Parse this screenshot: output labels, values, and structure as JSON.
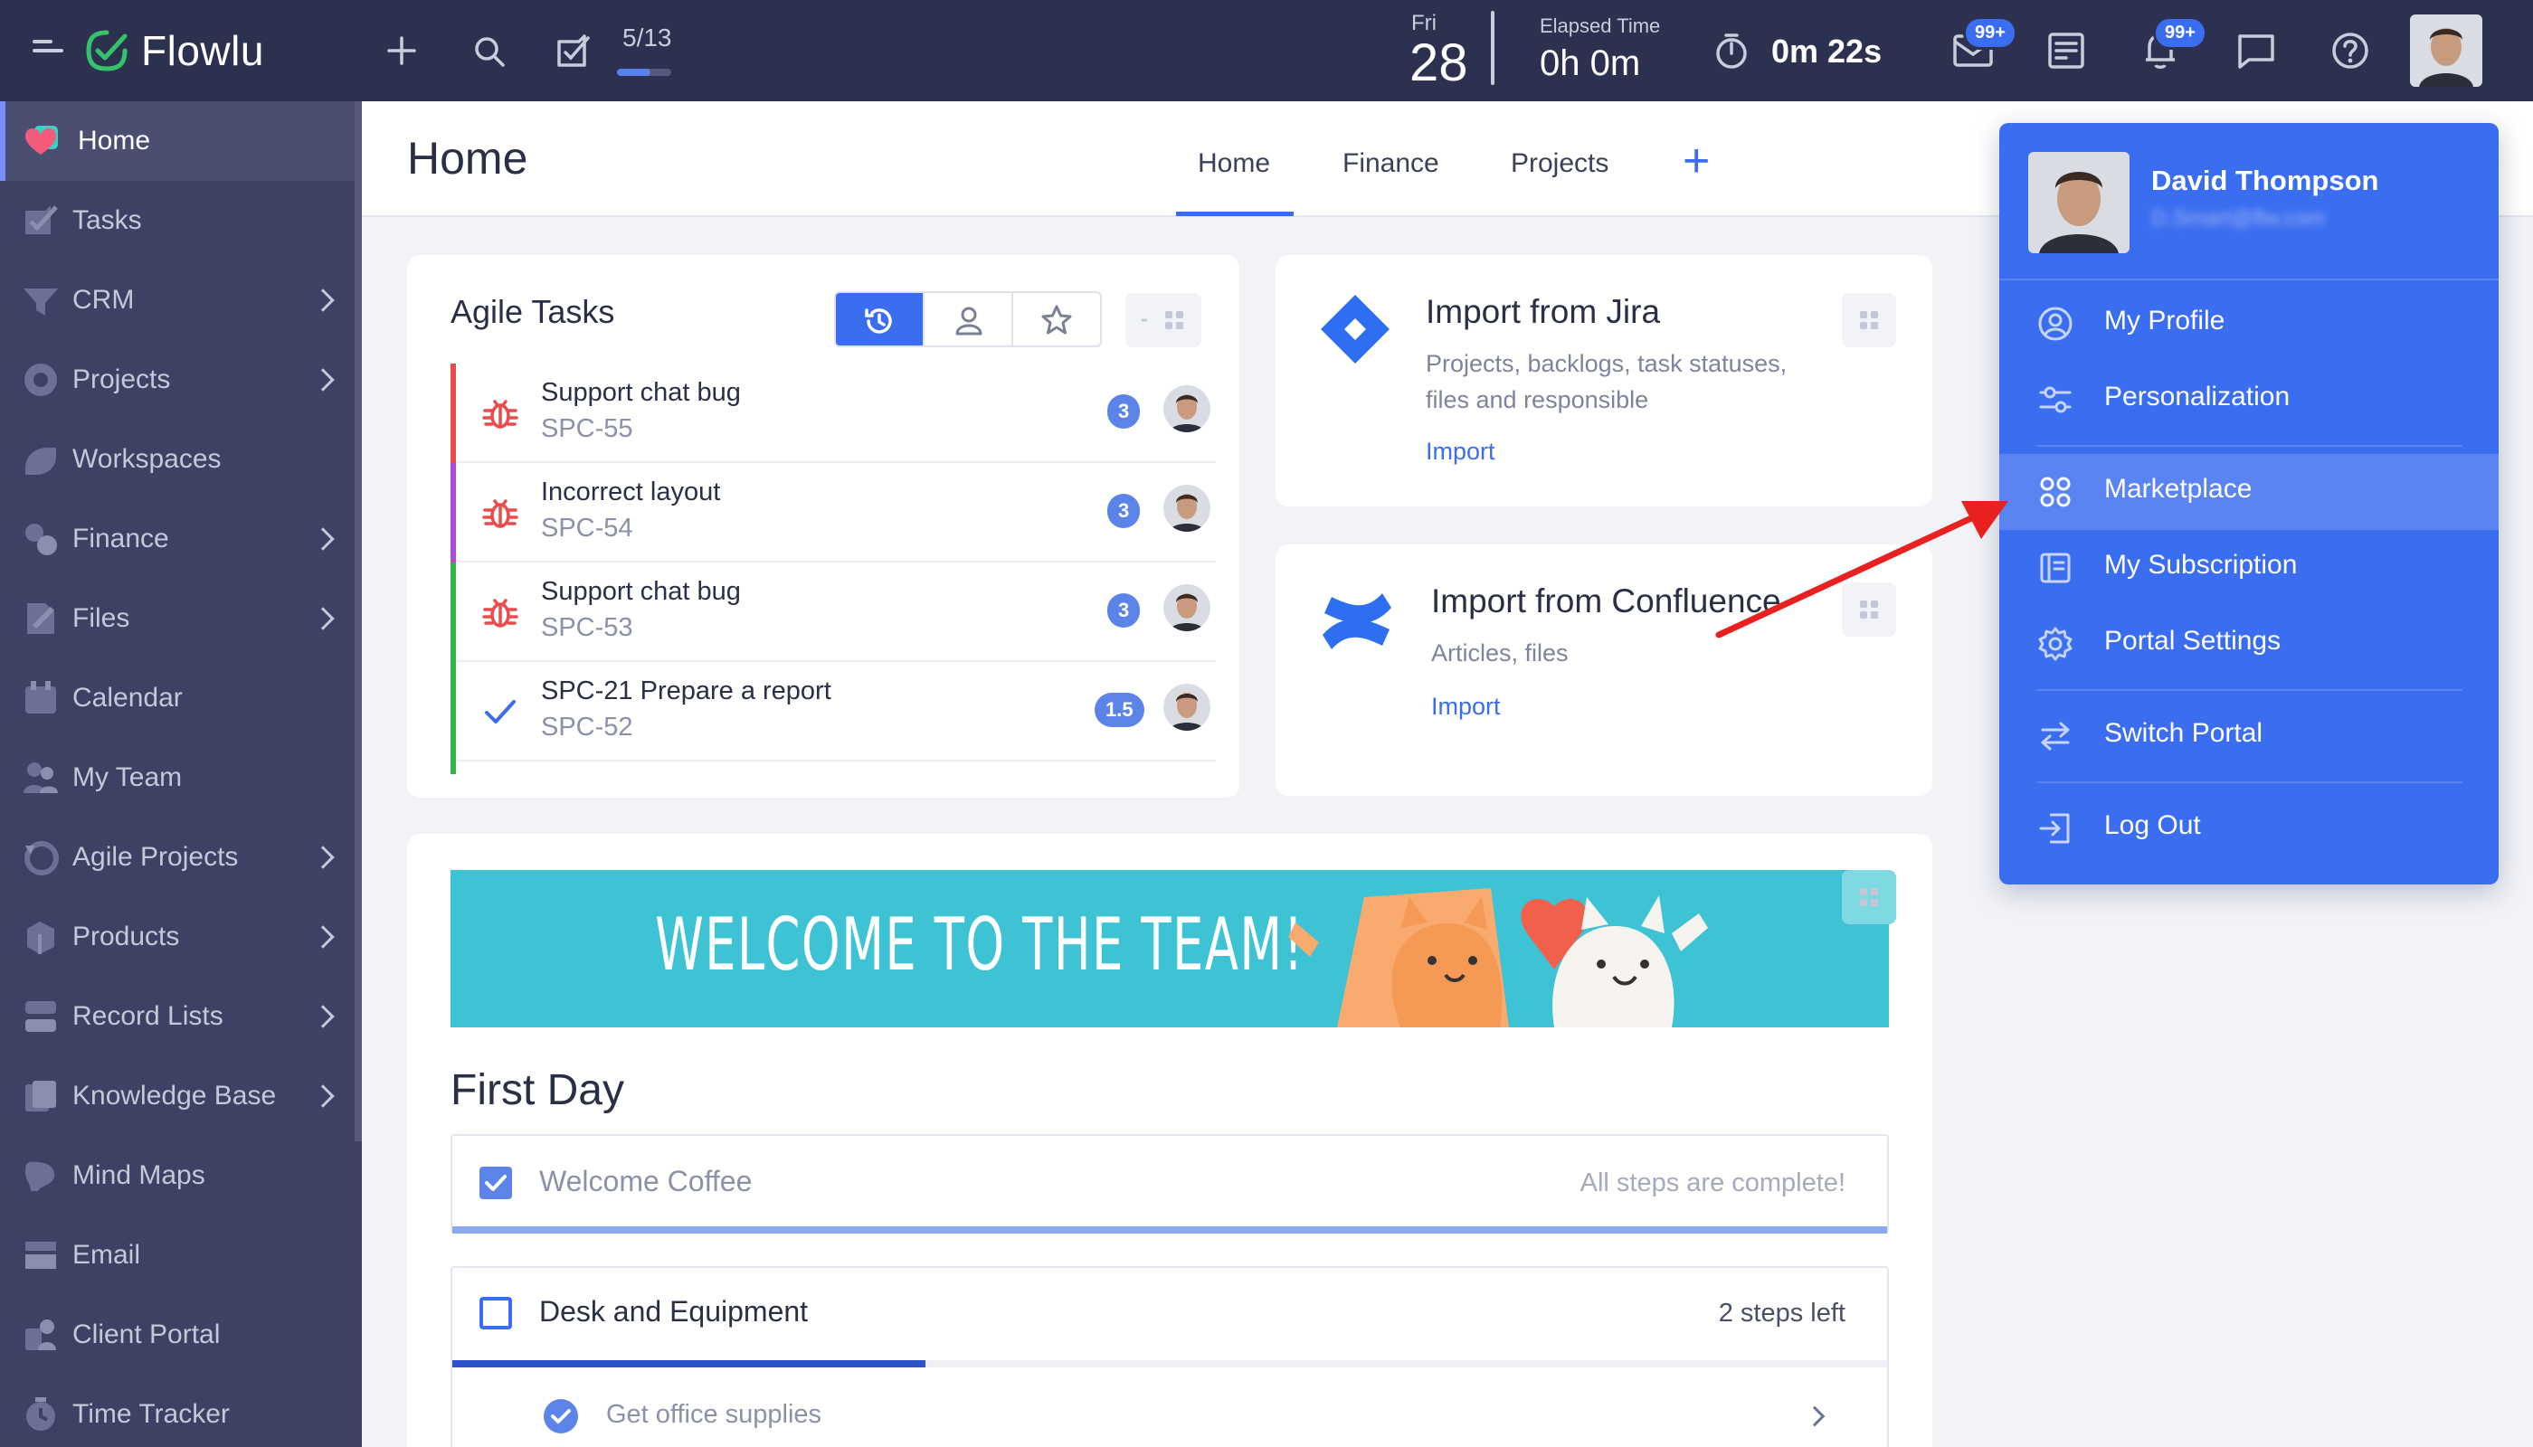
{
  "app": {
    "name": "Flowlu"
  },
  "topbar": {
    "counter": "5/13",
    "date_day": "Fri",
    "date_num": "28",
    "elapsed_label": "Elapsed Time",
    "elapsed_value": "0h 0m",
    "timer_value": "0m 22s",
    "mail_badge": "99+",
    "notif_badge": "99+",
    "counter_progress": 0.62
  },
  "sidebar": {
    "items": [
      {
        "label": "Home",
        "active": true
      },
      {
        "label": "Tasks"
      },
      {
        "label": "CRM"
      },
      {
        "label": "Projects"
      },
      {
        "label": "Workspaces"
      },
      {
        "label": "Finance"
      },
      {
        "label": "Files"
      },
      {
        "label": "Calendar"
      },
      {
        "label": "My Team"
      },
      {
        "label": "Agile Projects"
      },
      {
        "label": "Products"
      },
      {
        "label": "Record Lists"
      },
      {
        "label": "Knowledge Base"
      },
      {
        "label": "Mind Maps"
      },
      {
        "label": "Email"
      },
      {
        "label": "Client Portal"
      },
      {
        "label": "Time Tracker"
      }
    ]
  },
  "header": {
    "title": "Home",
    "tabs": [
      "Home",
      "Finance",
      "Projects"
    ]
  },
  "agile": {
    "title": "Agile Tasks",
    "tasks": [
      {
        "name": "Support chat bug",
        "code": "SPC-55",
        "badge": "3"
      },
      {
        "name": "Incorrect layout",
        "code": "SPC-54",
        "badge": "3"
      },
      {
        "name": "Support chat bug",
        "code": "SPC-53",
        "badge": "3"
      },
      {
        "name": "SPC-21 Prepare a report",
        "code": "SPC-52",
        "badge": "1.5"
      }
    ],
    "colors": {
      "red": "#ea4b4b",
      "purple": "#b04bd0",
      "green": "#36b24a"
    }
  },
  "jira": {
    "title": "Import from Jira",
    "desc_line1": "Projects, backlogs, task statuses,",
    "desc_line2": "files and responsible",
    "link": "Import"
  },
  "confluence": {
    "title": "Import from Confluence",
    "desc": "Articles, files",
    "link": "Import"
  },
  "banner": {
    "text": "WELCOME TO THE TEAM!"
  },
  "first_day": {
    "title": "First Day",
    "steps": [
      {
        "label": "Welcome Coffee",
        "status": "All steps are complete!",
        "done": true,
        "progress": 1.0
      },
      {
        "label": "Desk and Equipment",
        "status": "2 steps left",
        "done": false,
        "progress": 0.33
      }
    ],
    "substep": "Get office supplies"
  },
  "dropdown": {
    "name": "David Thompson",
    "email": "D.Smart@flw.com",
    "items": [
      "My Profile",
      "Personalization",
      "Marketplace",
      "My Subscription",
      "Portal Settings",
      "Switch Portal",
      "Log Out"
    ]
  }
}
